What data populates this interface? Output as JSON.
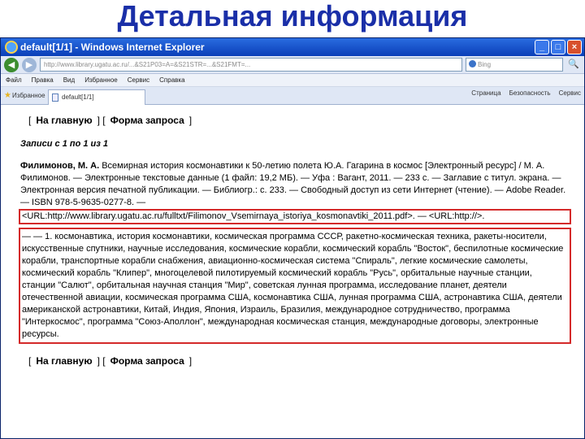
{
  "slide": {
    "title": "Детальная информация"
  },
  "window": {
    "title": "default[1/1] - Windows Internet Explorer",
    "controls": {
      "minimize": "_",
      "maximize": "□",
      "close": "×"
    }
  },
  "addressbar": {
    "back": "◀",
    "forward": "▶",
    "address": "http://www.library.ugatu.ac.ru/...&S21P03=A=&S21STR=...&S21FMT=...",
    "search_placeholder": "Bing",
    "search_button": "🔍"
  },
  "menubar": {
    "items": [
      "Файл",
      "Правка",
      "Вид",
      "Избранное",
      "Сервис",
      "Справка"
    ]
  },
  "tabbar": {
    "favorites": "Избранное",
    "tab_label": "default[1/1]",
    "right_items": [
      "Страница",
      "Безопасность",
      "Сервис"
    ]
  },
  "content": {
    "nav": {
      "home": "На главную",
      "query": "Форма запроса"
    },
    "records_label": "Записи с 1 по 1 из 1",
    "entry": {
      "author": "Филимонов, М. А.",
      "body": " Всемирная история космонавтики к 50-летию полета Ю.А. Гагарина в космос [Электронный ресурс] / М. А. Филимонов. — Электронные текстовые данные (1 файл: 19,2 МБ). — Уфа : Вагант, 2011. — 233 с. — Заглавие с титул. экрана. — Электронная версия печатной публикации. — Библиогр.: с. 233. — Свободный доступ из сети Интернет (чтение). — Adobe Reader. — ISBN 978-5-9635-0277-8. —",
      "url_line": "<URL:http://www.library.ugatu.ac.ru/fulltxt/Filimonov_Vsemirnaya_istoriya_kosmonavtiki_2011.pdf>. — <URL:http://>.",
      "subjects": "— — 1. космонавтика, история космонавтики, космическая программа СССР, ракетно-космическая техника, ракеты-носители, искусственные спутники, научные исследования, космические корабли, космический корабль \"Восток\", беспилотные космические корабли, транспортные корабли снабжения, авиационно-космическая система \"Спираль\", легкие космические самолеты, космический корабль \"Клипер\", многоцелевой пилотируемый космический корабль \"Русь\", орбитальные научные станции, станции \"Салют\", орбитальная научная станция \"Мир\", советская лунная программа, исследование планет, деятели отечественной авиации, космическая программа США, космонавтика США, лунная программа США, астронавтика США, деятели американской астронавтики, Китай, Индия, Япония, Израиль, Бразилия, международное сотрудничество, программа \"Интеркосмос\", программа \"Союз-Аполлон\", международная космическая станция, международные договоры, электронные ресурсы."
    }
  }
}
